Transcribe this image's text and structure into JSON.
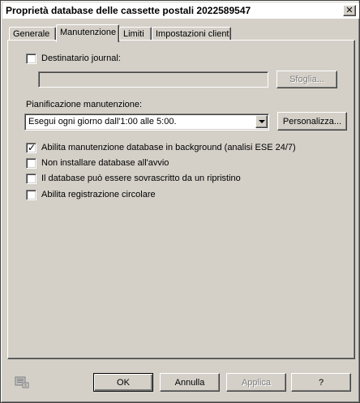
{
  "window": {
    "title": "Proprietà database delle cassette postali 2022589547",
    "close_glyph": "✕"
  },
  "tabs": [
    {
      "label": "Generale",
      "active": false
    },
    {
      "label": "Manutenzione",
      "active": true
    },
    {
      "label": "Limiti",
      "active": false
    },
    {
      "label": "Impostazioni client",
      "active": false
    }
  ],
  "journal": {
    "checkbox_label": "Destinatario journal:",
    "checked": false,
    "field_value": "",
    "browse_label": "Sfoglia..."
  },
  "schedule": {
    "label": "Pianificazione manutenzione:",
    "selected": "Esegui ogni giorno dall'1:00 alle 5:00.",
    "customize_label": "Personalizza..."
  },
  "options": [
    {
      "label": "Abilita manutenzione database in background (analisi ESE 24/7)",
      "checked": true
    },
    {
      "label": "Non installare database all'avvio",
      "checked": false
    },
    {
      "label": "Il database può essere sovrascritto da un ripristino",
      "checked": false
    },
    {
      "label": "Abilita registrazione circolare",
      "checked": false
    }
  ],
  "footer": {
    "ok": "OK",
    "cancel": "Annulla",
    "apply": "Applica",
    "help": "?",
    "help_icon": "properties-help-icon"
  }
}
